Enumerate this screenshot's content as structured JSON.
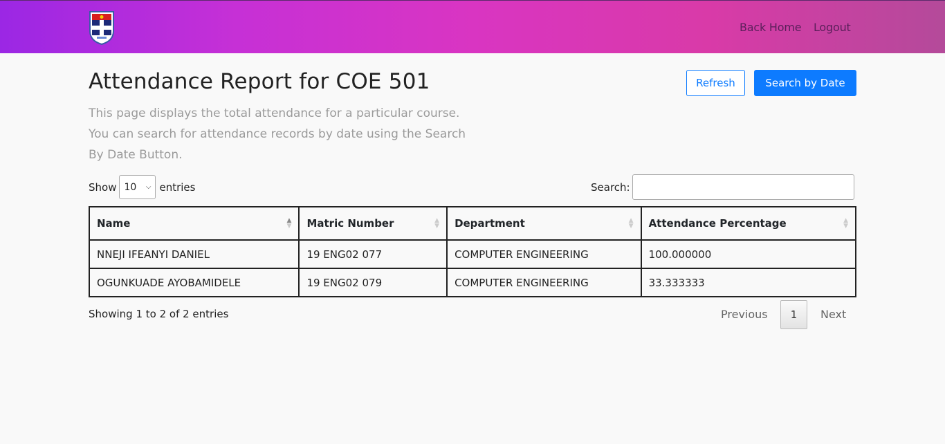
{
  "nav": {
    "back_home": "Back Home",
    "logout": "Logout"
  },
  "header": {
    "title": "Attendance Report for COE 501",
    "description": "This page displays the total attendance for a particular course. You can search for attendance records by date using the Search By Date Button.",
    "refresh_label": "Refresh",
    "search_by_date_label": "Search by Date"
  },
  "table_controls": {
    "show_label": "Show",
    "entries_value": "10",
    "entries_label": "entries",
    "search_label": "Search:",
    "search_value": ""
  },
  "table": {
    "columns": [
      "Name",
      "Matric Number",
      "Department",
      "Attendance Percentage"
    ],
    "rows": [
      [
        "NNEJI IFEANYI DANIEL",
        "19 ENG02 077",
        "COMPUTER ENGINEERING",
        "100.000000"
      ],
      [
        "OGUNKUADE AYOBAMIDELE",
        "19 ENG02 079",
        "COMPUTER ENGINEERING",
        "33.333333"
      ]
    ]
  },
  "footer": {
    "info": "Showing 1 to 2 of 2 entries",
    "previous": "Previous",
    "current_page": "1",
    "next": "Next"
  },
  "colors": {
    "primary": "#0d7bff",
    "gradient_start": "#9b27e4",
    "gradient_end": "#b44a9a"
  }
}
